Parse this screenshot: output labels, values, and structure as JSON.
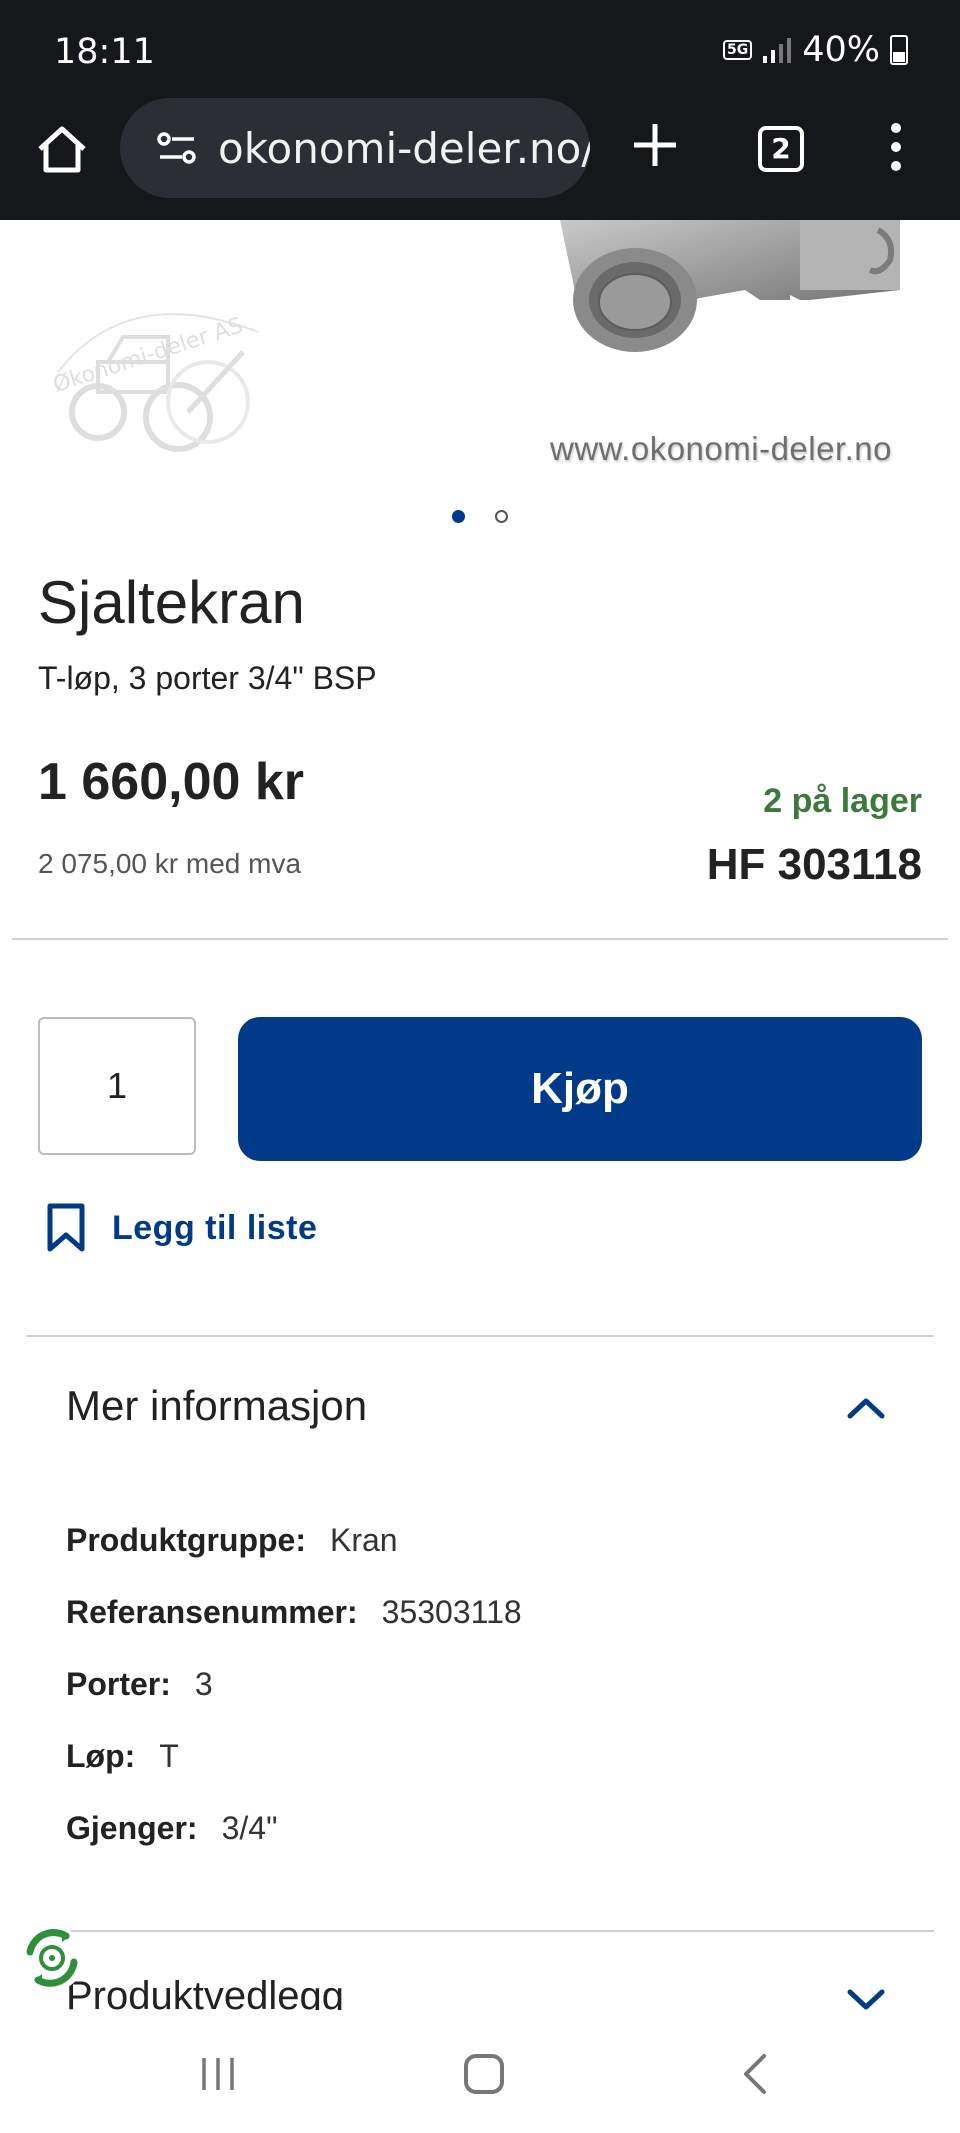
{
  "status_bar": {
    "time": "18:11",
    "network": "5G",
    "battery": "40%"
  },
  "browser": {
    "url": "okonomi-deler.no/sj",
    "tab_count": "2"
  },
  "hero": {
    "watermark_url": "www.okonomi-deler.no",
    "logo_text": "Økonomi-deler AS",
    "carousel_dots": 2,
    "active_dot": 1
  },
  "product": {
    "title": "Sjaltekran",
    "subtitle": "T-løp, 3 porter 3/4\" BSP",
    "price": "1 660,00 kr",
    "price_vat": "2 075,00 kr med mva",
    "stock": "2 på lager",
    "sku": "HF 303118"
  },
  "purchase": {
    "quantity": "1",
    "buy_label": "Kjøp",
    "wishlist_label": "Legg til liste"
  },
  "more_info": {
    "title": "Mer informasjon",
    "specs": [
      {
        "label": "Produktgruppe:",
        "value": "Kran"
      },
      {
        "label": "Referansenummer:",
        "value": "35303118"
      },
      {
        "label": "Porter:",
        "value": "3"
      },
      {
        "label": "Løp:",
        "value": "T"
      },
      {
        "label": "Gjenger:",
        "value": "3/4\""
      }
    ]
  },
  "attachments": {
    "title": "Produktvedlegg"
  },
  "colors": {
    "brand": "#003a88",
    "stock_green": "#3b7a3c",
    "toolbar": "#16171b"
  }
}
